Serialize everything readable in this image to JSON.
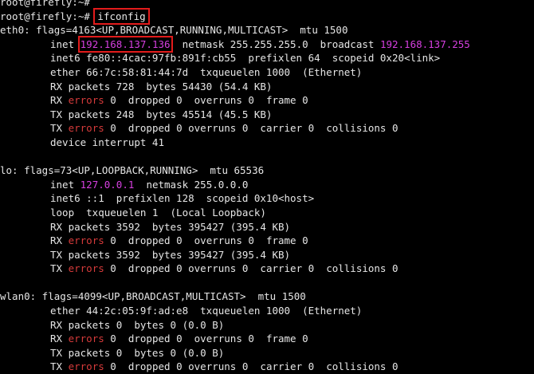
{
  "terminal": {
    "prompt1": "root@firefly:~#",
    "prompt2": "root@firefly:~#",
    "command": "ifconfig",
    "eth0": {
      "header": "eth0: flags=4163<UP,BROADCAST,RUNNING,MULTICAST>  mtu 1500",
      "inet_label": "inet",
      "inet_addr": "192.168.137.136",
      "netmask_text": "netmask 255.255.255.0  broadcast",
      "broadcast_addr": "192.168.137.255",
      "inet6": "inet6 fe80::4cac:97fb:891f:cb55  prefixlen 64  scopeid 0x20<link>",
      "ether": "ether 66:7c:58:81:44:7d  txqueuelen 1000  (Ethernet)",
      "rx_packets": "RX packets 728  bytes 54430 (54.4 KB)",
      "rx_errors_prefix": "RX",
      "errors_word": "errors",
      "rx_errors_rest": "0  dropped 0  overruns 0  frame 0",
      "tx_packets": "TX packets 248  bytes 45514 (45.5 KB)",
      "tx_errors_prefix": "TX",
      "tx_errors_rest": "0  dropped 0 overruns 0  carrier 0  collisions 0",
      "device_interrupt": "device interrupt 41"
    },
    "lo": {
      "header": "lo: flags=73<UP,LOOPBACK,RUNNING>  mtu 65536",
      "inet_label": "inet",
      "inet_addr": "127.0.0.1",
      "netmask_text": "netmask 255.0.0.0",
      "inet6": "inet6 ::1  prefixlen 128  scopeid 0x10<host>",
      "loop": "loop  txqueuelen 1  (Local Loopback)",
      "rx_packets": "RX packets 3592  bytes 395427 (395.4 KB)",
      "rx_errors_prefix": "RX",
      "errors_word": "errors",
      "rx_errors_rest": "0  dropped 0  overruns 0  frame 0",
      "tx_packets": "TX packets 3592  bytes 395427 (395.4 KB)",
      "tx_errors_prefix": "TX",
      "tx_errors_rest": "0  dropped 0 overruns 0  carrier 0  collisions 0"
    },
    "wlan0": {
      "header": "wlan0: flags=4099<UP,BROADCAST,MULTICAST>  mtu 1500",
      "ether": "ether 44:2c:05:9f:ad:e8  txqueuelen 1000  (Ethernet)",
      "rx_packets": "RX packets 0  bytes 0 (0.0 B)",
      "rx_errors_prefix": "RX",
      "errors_word": "errors",
      "rx_errors_rest": "0  dropped 0  overruns 0  frame 0",
      "tx_packets": "TX packets 0  bytes 0 (0.0 B)",
      "tx_errors_prefix": "TX",
      "tx_errors_rest": "0  dropped 0 overruns 0  carrier 0  collisions 0"
    },
    "colors": {
      "background": "#000000",
      "text": "#e6e6e6",
      "errors": "#d73b3b",
      "address": "#d63fe0",
      "highlight_box": "#e31b1b"
    }
  }
}
